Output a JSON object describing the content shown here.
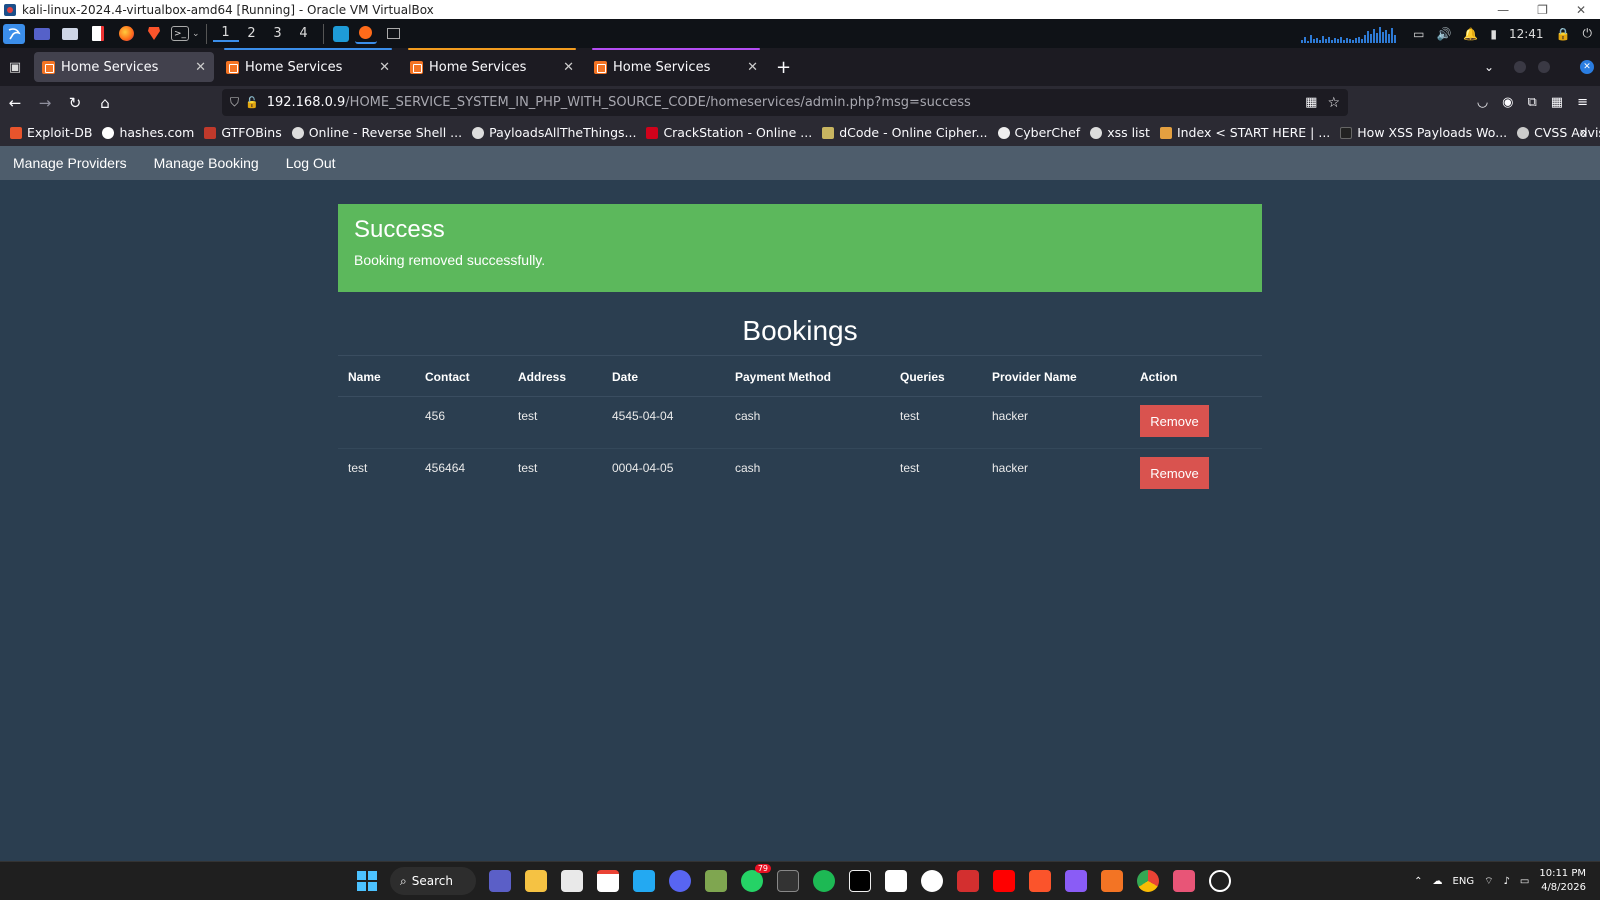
{
  "vbox": {
    "title": "kali-linux-2024.4-virtualbox-amd64 [Running] - Oracle VM VirtualBox",
    "minimize": "—",
    "restore": "❐",
    "close": "✕"
  },
  "kali_panel": {
    "workspaces": [
      "1",
      "2",
      "3",
      "4"
    ],
    "time": "12:41"
  },
  "browser": {
    "tabs": [
      {
        "label": "Home Services",
        "close": "✕"
      },
      {
        "label": "Home Services",
        "close": "✕"
      },
      {
        "label": "Home Services",
        "close": "✕"
      },
      {
        "label": "Home Services",
        "close": "✕"
      }
    ],
    "new_tab": "+",
    "url_host": "192.168.0.9",
    "url_path": "/HOME_SERVICE_SYSTEM_IN_PHP_WITH_SOURCE_CODE/homeservices/admin.php?msg=success",
    "bookmarks": [
      {
        "label": "Exploit-DB",
        "color": "#e8542c"
      },
      {
        "label": "hashes.com",
        "color": "#ffffff"
      },
      {
        "label": "GTFOBins",
        "color": "#c0392b"
      },
      {
        "label": "Online - Reverse Shell ...",
        "color": "#dddddd"
      },
      {
        "label": "PayloadsAllTheThings...",
        "color": "#dddddd"
      },
      {
        "label": "CrackStation - Online ...",
        "color": "#d0021b"
      },
      {
        "label": "dCode - Online Cipher...",
        "color": "#c8b560"
      },
      {
        "label": "CyberChef",
        "color": "#eeeeee"
      },
      {
        "label": "xss list",
        "color": "#dddddd"
      },
      {
        "label": "Index < START HERE | ...",
        "color": "#e4a040"
      },
      {
        "label": "How XSS Payloads Wo...",
        "color": "#222222"
      },
      {
        "label": "CVSS Advisor: A tool t...",
        "color": "#cccccc"
      }
    ]
  },
  "site": {
    "nav": [
      "Manage Providers",
      "Manage Booking",
      "Log Out"
    ],
    "alert": {
      "title": "Success",
      "message": "Booking removed successfully."
    },
    "bookings_title": "Bookings",
    "columns": [
      "Name",
      "Contact",
      "Address",
      "Date",
      "Payment Method",
      "Queries",
      "Provider Name",
      "Action"
    ],
    "rows": [
      {
        "name": "",
        "contact": "456",
        "address": "test",
        "date": "4545-04-04",
        "payment": "cash",
        "queries": "test",
        "provider": "hacker",
        "action": "Remove"
      },
      {
        "name": "test",
        "contact": "456464",
        "address": "test",
        "date": "0004-04-05",
        "payment": "cash",
        "queries": "test",
        "provider": "hacker",
        "action": "Remove"
      }
    ],
    "colors": {
      "nav_bg": "#4e5d6c",
      "page_bg": "#2b3e50",
      "alert_bg": "#5cb85c",
      "remove_btn": "#d9534f"
    }
  },
  "taskbar": {
    "search": "Search",
    "badge": "79",
    "lang": "ENG",
    "time": "10:11 PM",
    "date": "4/8/2026"
  }
}
